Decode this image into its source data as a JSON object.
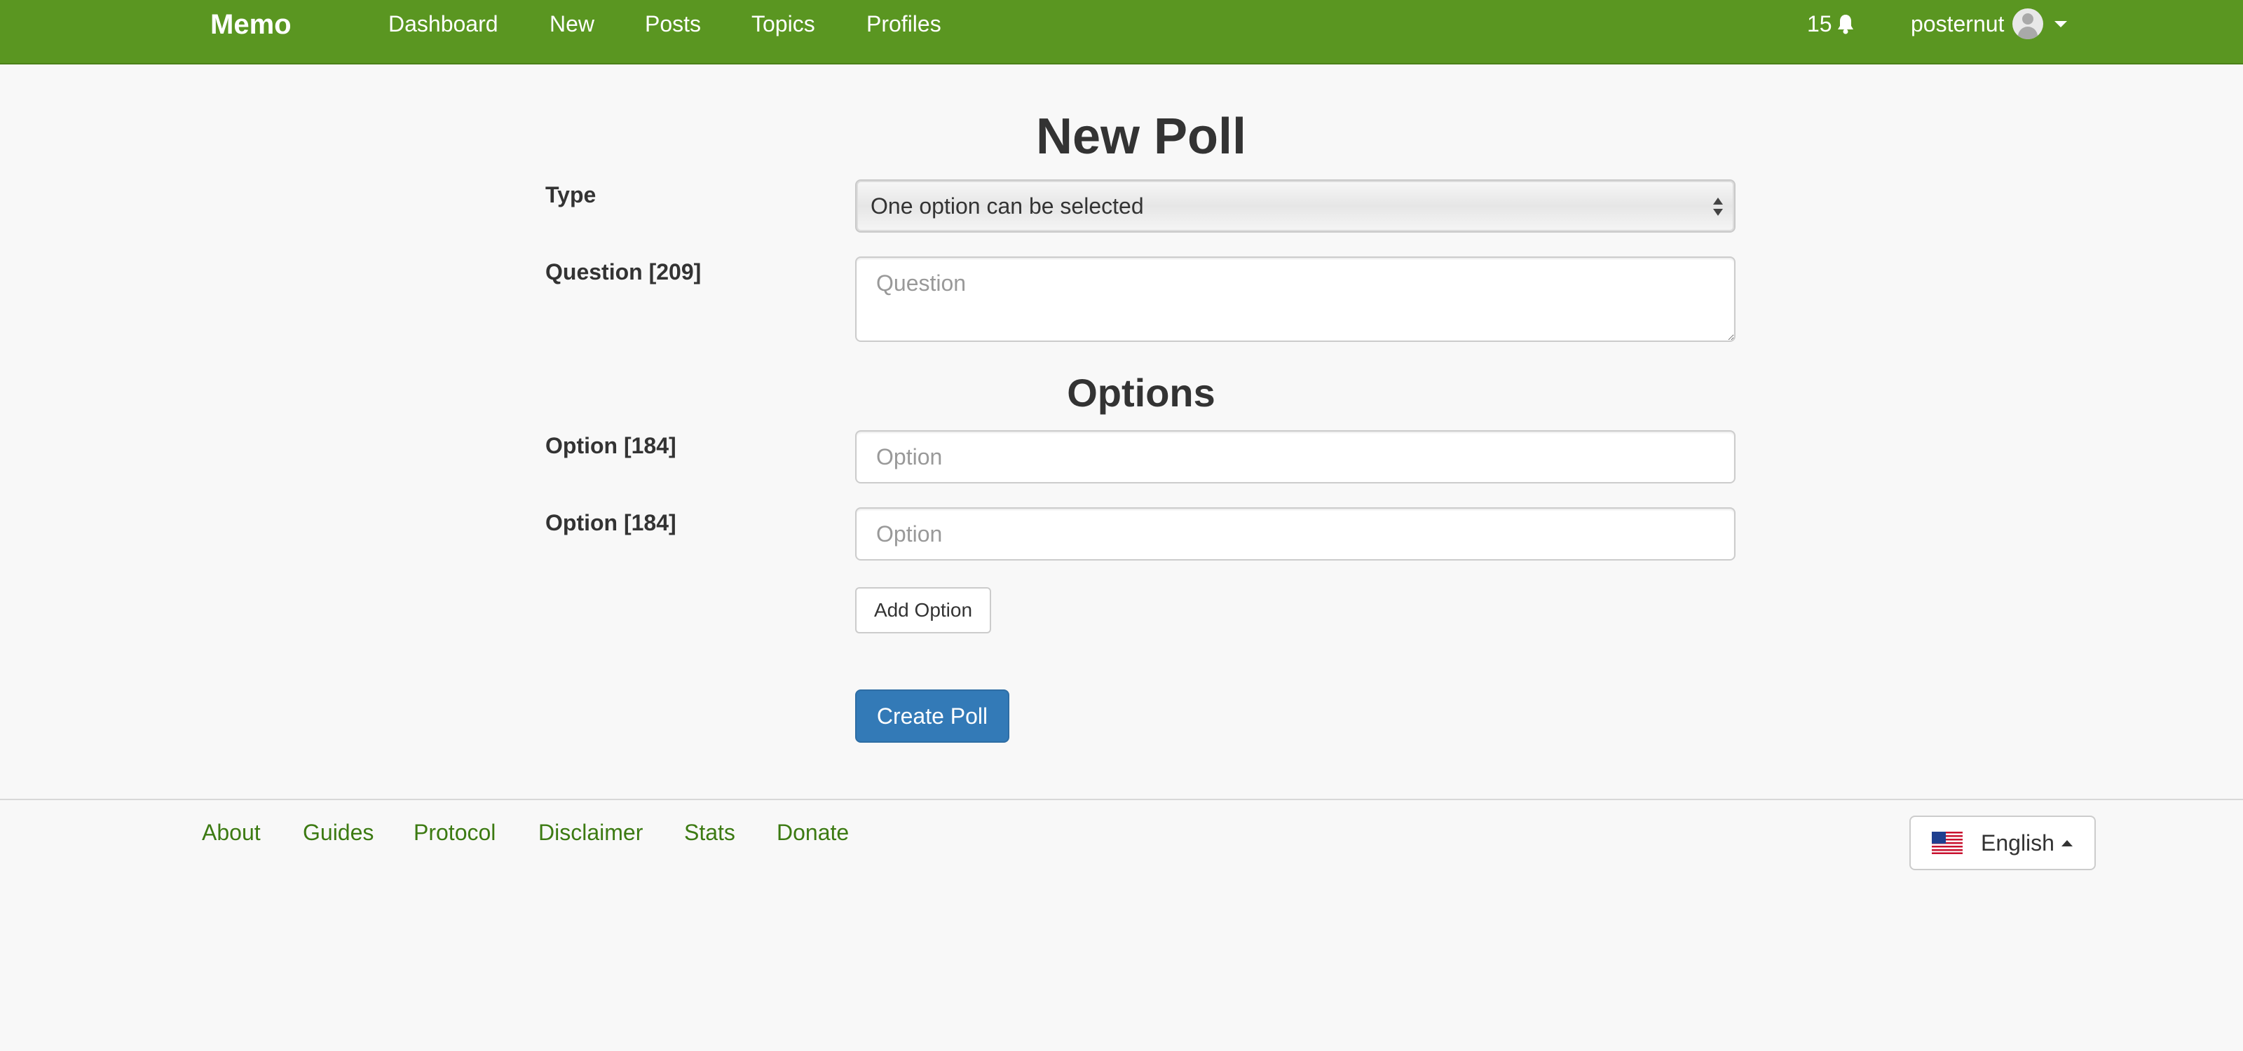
{
  "navbar": {
    "brand": "Memo",
    "links": [
      "Dashboard",
      "New",
      "Posts",
      "Topics",
      "Profiles"
    ],
    "notification_count": "15",
    "notification_icon": "bell-icon",
    "username": "posternut",
    "bg_color": "#5a9621"
  },
  "form": {
    "title": "New Poll",
    "type_label": "Type",
    "type_selected": "One option can be selected",
    "question_label": "Question [209]",
    "question_placeholder": "Question",
    "options_title": "Options",
    "options": [
      {
        "label": "Option [184]",
        "placeholder": "Option"
      },
      {
        "label": "Option [184]",
        "placeholder": "Option"
      }
    ],
    "add_option_label": "Add Option",
    "create_label": "Create Poll",
    "primary_color": "#337ab7"
  },
  "footer": {
    "links": [
      "About",
      "Guides",
      "Protocol",
      "Disclaimer",
      "Stats",
      "Donate"
    ],
    "language": "English",
    "language_flag": "us-flag-icon",
    "link_color": "#3c7a12"
  }
}
